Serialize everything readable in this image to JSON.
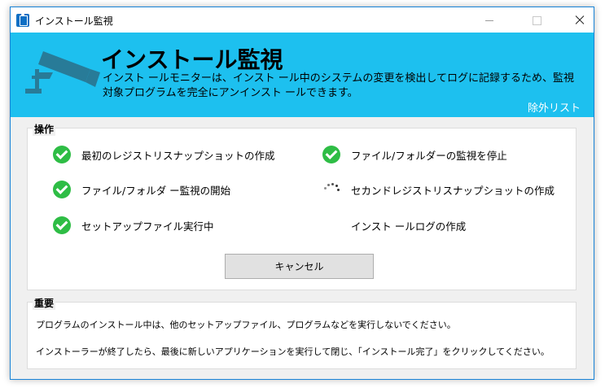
{
  "window": {
    "title": "インストール監視"
  },
  "banner": {
    "title": "インストール監視",
    "description": "インスト ールモニターは、インスト ール中のシステムの変更を検出してログに記録するため、監視対象プログラムを完全にアンインスト ールできます。",
    "exclusion_link": "除外リスト"
  },
  "operations": {
    "label": "操作",
    "tasks": [
      {
        "label": "最初のレジストリスナップショットの作成",
        "status": "done"
      },
      {
        "label": "ファイル/フォルダ ー監視の開始",
        "status": "done"
      },
      {
        "label": "セットアップファイル実行中",
        "status": "done"
      },
      {
        "label": "ファイル/フォルダーの監視を停止",
        "status": "done"
      },
      {
        "label": "セカンドレジストリスナップショットの作成",
        "status": "running"
      },
      {
        "label": "インスト ールログの作成",
        "status": "pending"
      }
    ],
    "cancel_label": "キャンセル"
  },
  "important": {
    "label": "重要",
    "line1": "プログラムのインストール中は、他のセットアップファイル、プログラムなどを実行しないでください。",
    "line2": "インストーラーが終了したら、最後に新しいアプリケーションを実行して閉じ、「インストール完了」をクリックしてください。"
  },
  "colors": {
    "banner": "#1dc0ef",
    "check": "#2ebd45",
    "window_border": "#1883d7"
  }
}
